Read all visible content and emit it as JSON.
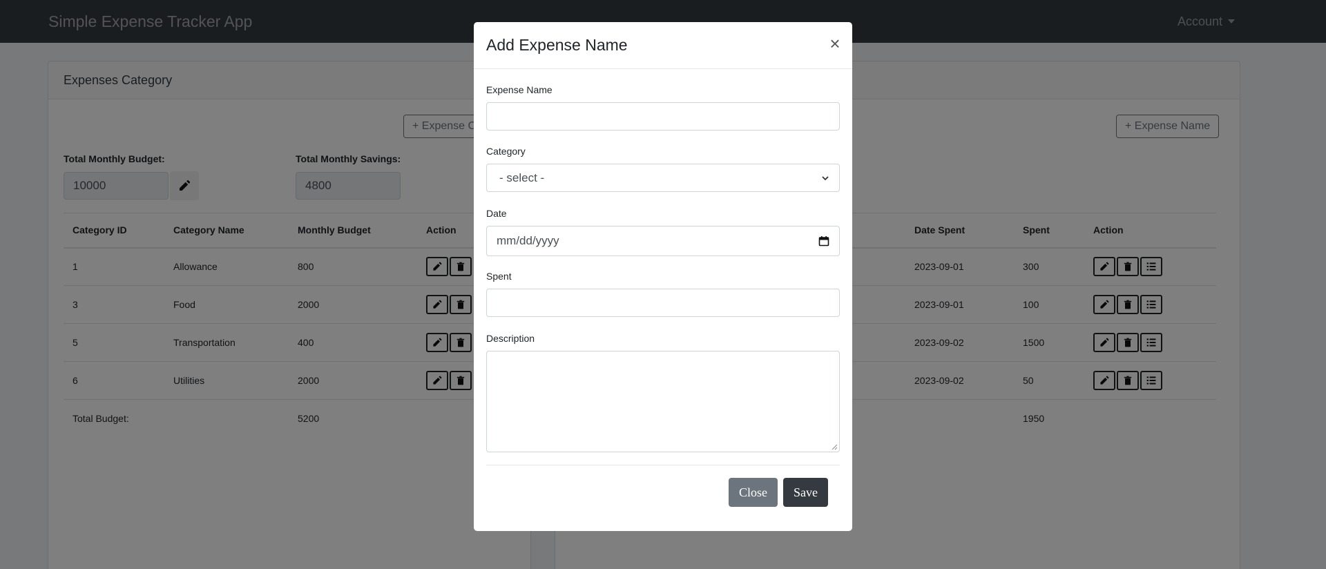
{
  "navbar": {
    "brand": "Simple Expense Tracker App",
    "account_label": "Account"
  },
  "left_card": {
    "title": "Expenses Category",
    "add_button_label": "+ Expense Category",
    "budget_label": "Total Monthly Budget:",
    "budget_value": "10000",
    "savings_label": "Total Monthly Savings:",
    "savings_value": "4800",
    "columns": [
      "Category ID",
      "Category Name",
      "Monthly Budget",
      "Action"
    ],
    "rows": [
      {
        "id": "1",
        "name": "Allowance",
        "budget": "800"
      },
      {
        "id": "3",
        "name": "Food",
        "budget": "2000"
      },
      {
        "id": "5",
        "name": "Transportation",
        "budget": "400"
      },
      {
        "id": "6",
        "name": "Utilities",
        "budget": "2000"
      }
    ],
    "total_label": "Total Budget:",
    "total_value": "5200"
  },
  "right_card": {
    "add_button_label": "+ Expense Name",
    "columns": [
      "Date Spent",
      "Spent",
      "Action"
    ],
    "rows": [
      {
        "date": "2023-09-01",
        "spent": "300"
      },
      {
        "date": "2023-09-01",
        "spent": "100"
      },
      {
        "date": "2023-09-02",
        "spent": "1500"
      },
      {
        "date": "2023-09-02",
        "spent": "50"
      }
    ],
    "total_value": "1950"
  },
  "modal": {
    "title": "Add Expense Name",
    "close_symbol": "×",
    "expense_name_label": "Expense Name",
    "expense_name_value": "",
    "category_label": "Category",
    "category_selected": "- select -",
    "date_label": "Date",
    "date_placeholder": "mm/dd/yyyy",
    "spent_label": "Spent",
    "spent_value": "",
    "description_label": "Description",
    "description_value": "",
    "close_button": "Close",
    "save_button": "Save"
  },
  "colors": {
    "navbar": "#343a40",
    "secondary": "#6c757d",
    "dark": "#343a40",
    "backdrop": "rgba(0,0,0,0.5)"
  }
}
